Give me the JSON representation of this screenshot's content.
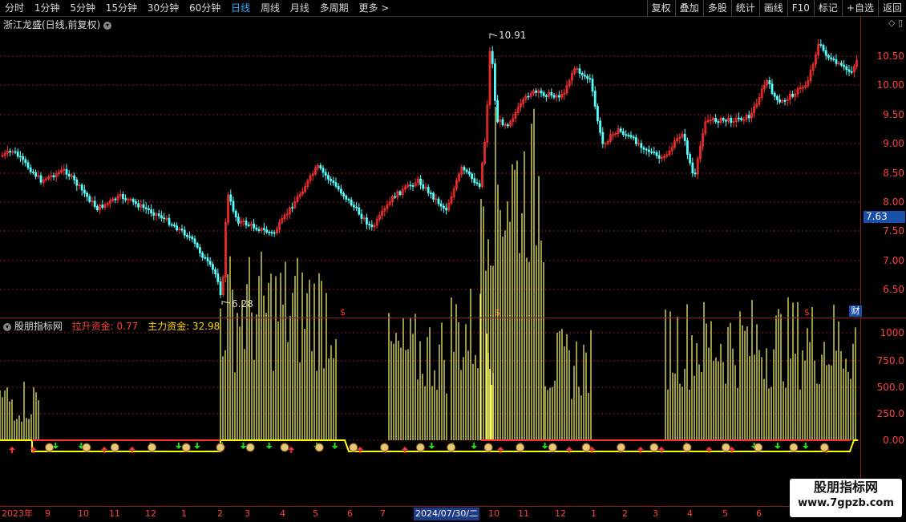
{
  "toolbar": {
    "periods": [
      "分时",
      "1分钟",
      "5分钟",
      "15分钟",
      "30分钟",
      "60分钟",
      "日线",
      "周线",
      "月线",
      "多周期",
      "更多 >"
    ],
    "active_period": "日线",
    "right_buttons": [
      "复权",
      "叠加",
      "多股",
      "统计",
      "画线",
      "F10",
      "标记",
      "+自选",
      "返回"
    ]
  },
  "main": {
    "title": "浙江龙盛(日线,前复权)",
    "current_price": "7.63",
    "high_label": "10.91",
    "low_label": "6.28",
    "cai_label": "财",
    "price_axis": [
      "10.50",
      "10.00",
      "9.50",
      "9.00",
      "8.50",
      "8.00",
      "7.50",
      "7.00",
      "6.50"
    ]
  },
  "indicator": {
    "name": "股朋指标网",
    "lsj_label": "拉升资金: 0.77",
    "zlj_label": "主力资金: 32.98",
    "axis": [
      "1000",
      "750.0",
      "500.0",
      "250.0",
      "0.00"
    ]
  },
  "date_axis": {
    "labels": [
      "2023年",
      "9",
      "10",
      "11",
      "12",
      "1",
      "2",
      "3",
      "4",
      "5",
      "6",
      "7",
      "2024/07/30/二",
      "10",
      "11",
      "12",
      "1",
      "2",
      "3",
      "4",
      "5",
      "6"
    ]
  },
  "watermark": {
    "line1": "股朋指标网",
    "line2": "www.7gpzb.com"
  },
  "colors": {
    "up": "#ff3030",
    "down": "#54ffff",
    "grid": "#8a1c1c",
    "volume_bars": "#ffff66",
    "cur_price_bg": "#1b4faa"
  }
}
